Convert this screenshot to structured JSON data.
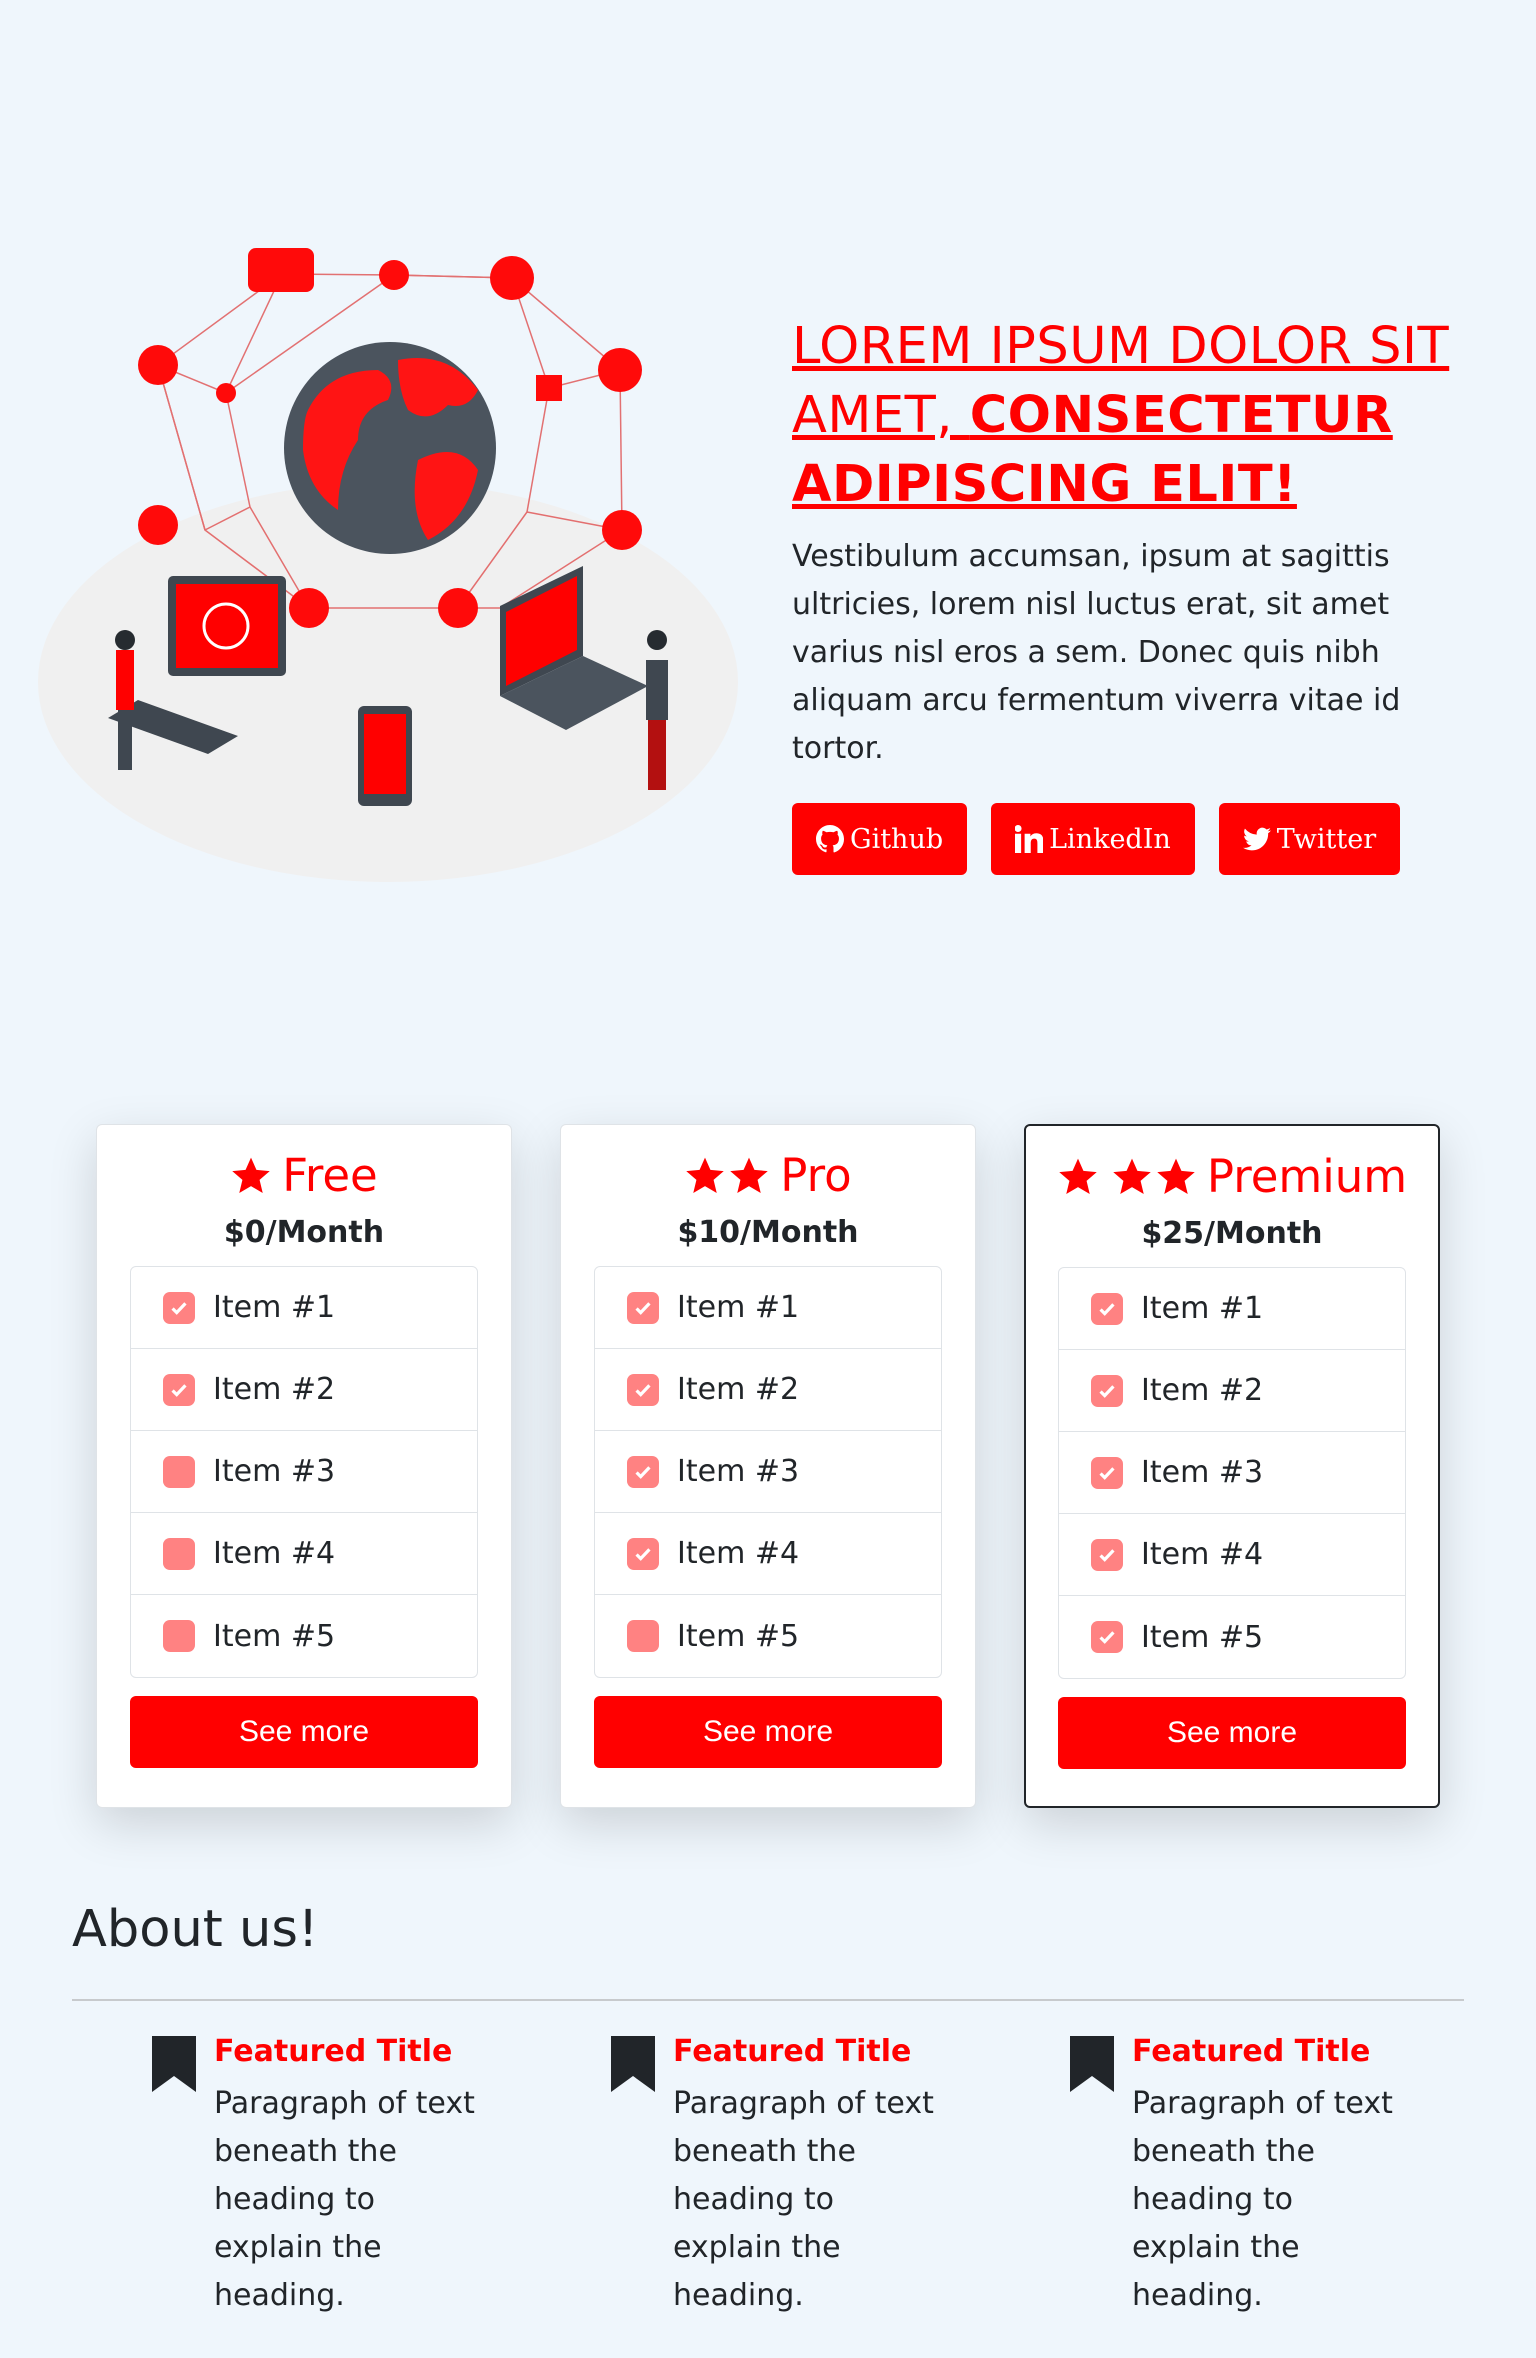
{
  "hero": {
    "title_part1": "LOREM IPSUM DOLOR SIT AMET, ",
    "title_part2": "CONSECTETUR ADIPISCING ELIT!",
    "description": "Vestibulum accumsan, ipsum at sagittis ultricies, lorem nisl luctus erat, sit amet varius nisl eros a sem. Donec quis nibh aliquam arcu fermentum viverra vitae id tortor.",
    "buttons": [
      {
        "label": "Github",
        "icon": "github-icon"
      },
      {
        "label": "LinkedIn",
        "icon": "linkedin-icon"
      },
      {
        "label": "Twitter",
        "icon": "twitter-icon"
      }
    ]
  },
  "pricing": {
    "plans": [
      {
        "title": "Free",
        "stars": 1,
        "price": "$0/Month",
        "items": [
          "Item #1",
          "Item #2",
          "Item #3",
          "Item #4",
          "Item #5"
        ],
        "checked": [
          true,
          true,
          false,
          false,
          false
        ],
        "button": "See more"
      },
      {
        "title": "Pro",
        "stars": 2,
        "price": "$10/Month",
        "items": [
          "Item #1",
          "Item #2",
          "Item #3",
          "Item #4",
          "Item #5"
        ],
        "checked": [
          true,
          true,
          true,
          true,
          false
        ],
        "button": "See more"
      },
      {
        "title": "Premium",
        "stars": 3,
        "price": "$25/Month",
        "items": [
          "Item #1",
          "Item #2",
          "Item #3",
          "Item #4",
          "Item #5"
        ],
        "checked": [
          true,
          true,
          true,
          true,
          true
        ],
        "button": "See more"
      }
    ]
  },
  "about": {
    "title": "About us!",
    "features": [
      {
        "title": "Featured Title",
        "text": "Paragraph of text beneath the heading to explain the heading."
      },
      {
        "title": "Featured Title",
        "text": "Paragraph of text beneath the heading to explain the heading."
      },
      {
        "title": "Featured Title",
        "text": "Paragraph of text beneath the heading to explain the heading."
      }
    ]
  },
  "colors": {
    "accent": "#ff0000",
    "background": "#eff6fc",
    "check": "#ff8282"
  }
}
